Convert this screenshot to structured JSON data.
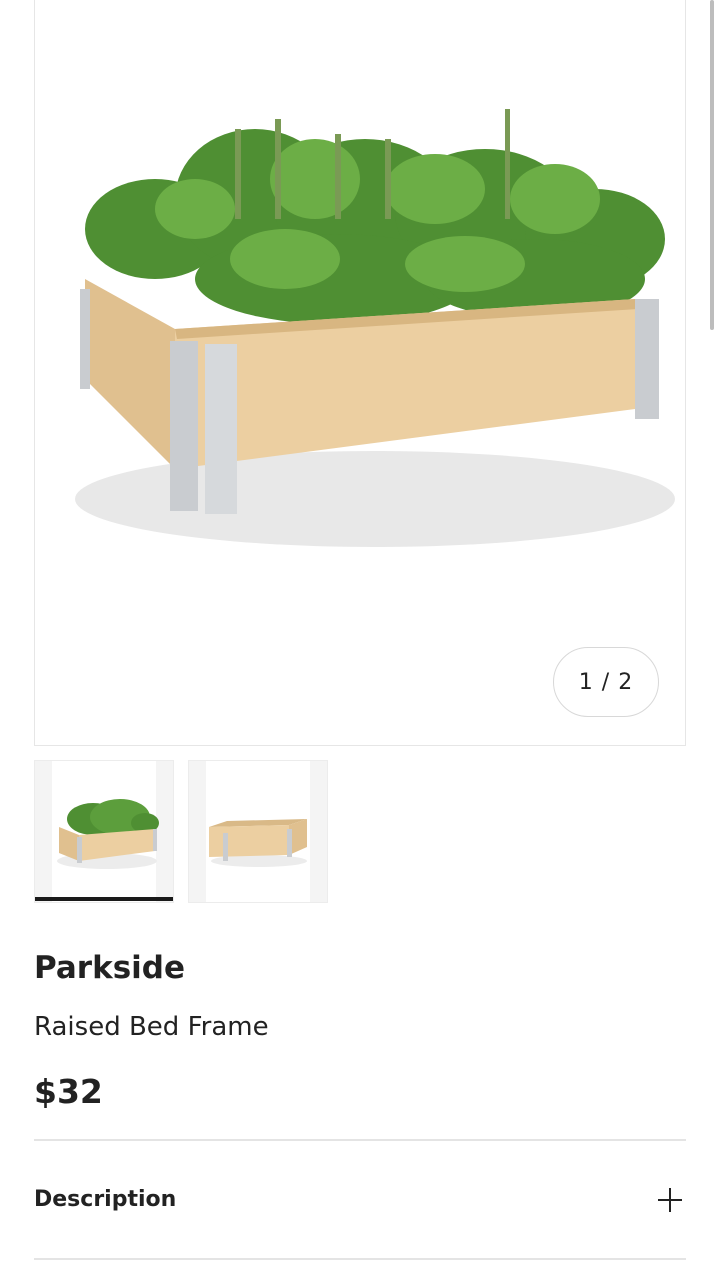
{
  "gallery": {
    "counter": "1 / 2",
    "images": [
      "raised-bed-with-herbs",
      "raised-bed-empty"
    ],
    "active_index": 0
  },
  "product": {
    "brand": "Parkside",
    "name": "Raised Bed Frame",
    "price": "$32"
  },
  "accordion": {
    "description_label": "Description"
  },
  "icons": {
    "expand": "plus-icon"
  },
  "colors": {
    "wood": "#e6c89a",
    "metal": "#c9ccd0",
    "foliage": "#5a9a3a",
    "active_indicator": "#1a1a1a"
  }
}
